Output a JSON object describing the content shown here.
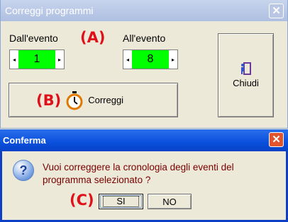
{
  "main_dialog": {
    "title": "Correggi programmi",
    "close_label": "✕",
    "from_label": "Dall'evento",
    "to_label": "All'evento",
    "from_value": "1",
    "to_value": "8",
    "marker_a": "(A)",
    "marker_b": "(B)",
    "fix_button_label": "Correggi",
    "close_button_label": "Chiudi"
  },
  "confirm_dialog": {
    "title": "Conferma",
    "close_label": "✕",
    "message_line1": "Vuoi correggere la cronologia degli eventi del",
    "message_line2": "programma selezionato ?",
    "marker_c": "(C)",
    "yes_label": "SI",
    "no_label": "NO"
  },
  "icons": {
    "spin_left": "◂",
    "spin_right": "▸",
    "question": "?"
  },
  "colors": {
    "value_field": "#00FF00",
    "marker": "#E0101B",
    "active_titlebar": "#0A50DC",
    "inactive_titlebar": "#AEBFE1"
  }
}
